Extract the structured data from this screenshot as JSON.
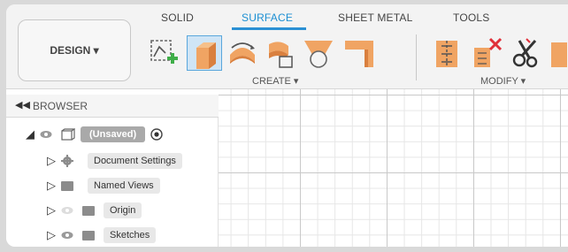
{
  "toolbar": {
    "workspace_label": "DESIGN ▾",
    "tabs": [
      {
        "label": "SOLID",
        "active": false
      },
      {
        "label": "SURFACE",
        "active": true
      },
      {
        "label": "SHEET METAL",
        "active": false
      },
      {
        "label": "TOOLS",
        "active": false
      }
    ],
    "groups": {
      "create_label": "CREATE ▾",
      "modify_label": "MODIFY ▾"
    },
    "tools": [
      "create-sketch-icon",
      "extrude-icon",
      "revolve-icon",
      "sweep-icon",
      "loft-icon",
      "patch-icon",
      "trim-icon",
      "untrim-icon",
      "extend-icon",
      "stitch-icon"
    ]
  },
  "browser": {
    "title": "BROWSER",
    "root": {
      "label": "(Unsaved)"
    },
    "items": [
      {
        "label": "Document Settings",
        "icon": "gear-icon"
      },
      {
        "label": "Named Views",
        "icon": "folder-icon"
      },
      {
        "label": "Origin",
        "icon": "folder-icon"
      },
      {
        "label": "Sketches",
        "icon": "folder-icon"
      }
    ]
  },
  "colors": {
    "accent": "#1c8fd3",
    "tool_orange": "#f0a463",
    "tool_orange_dark": "#d9803f",
    "sketch_green": "#3fae49",
    "delete_red": "#e0303a"
  }
}
